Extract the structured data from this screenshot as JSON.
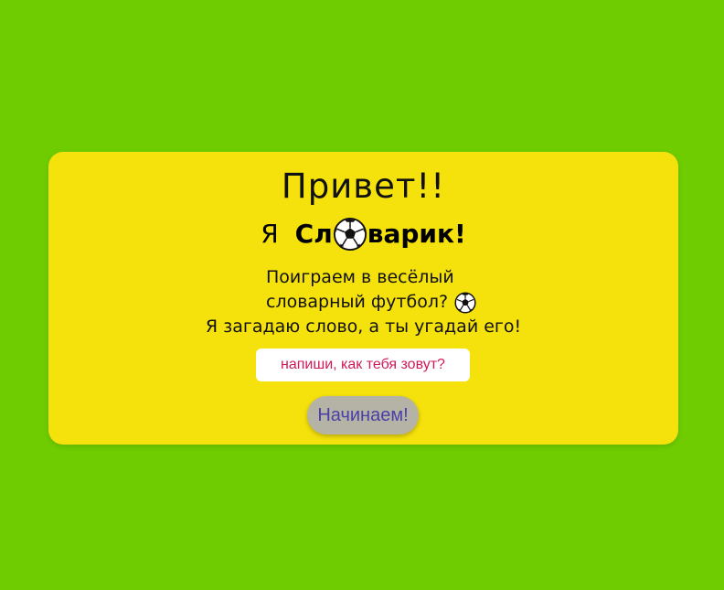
{
  "card": {
    "greeting": "Привет!!",
    "intro_prefix": "Я",
    "intro_name_start": "Сл",
    "intro_name_end": "варик!",
    "ball_icon": "soccer-ball-icon",
    "desc_line1": "Поиграем в весёлый",
    "desc_line2": "словарный футбол?",
    "desc_line3": "Я загадаю слово, а ты угадай его!",
    "name_placeholder": "напиши, как тебя зовут?",
    "name_value": "",
    "start_button": "Начинаем!"
  },
  "colors": {
    "background": "#6fcc00",
    "card": "#f5e10c",
    "placeholder": "#d0195a",
    "button_bg": "#b5b3a6",
    "button_text": "#4a40a8"
  }
}
